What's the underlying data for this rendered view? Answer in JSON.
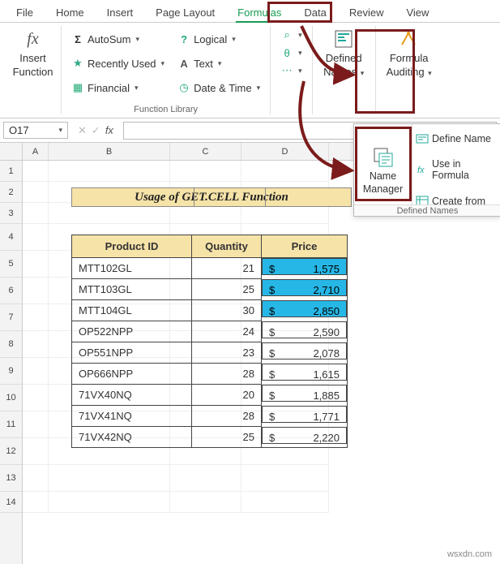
{
  "tabs": [
    "File",
    "Home",
    "Insert",
    "Page Layout",
    "Formulas",
    "Data",
    "Review",
    "View"
  ],
  "active_tab_index": 4,
  "ribbon": {
    "insert_function": {
      "label1": "Insert",
      "label2": "Function",
      "icon": "fx"
    },
    "library": {
      "auto_sum": "AutoSum",
      "recently_used": "Recently Used",
      "financial": "Financial",
      "logical": "Logical",
      "text": "Text",
      "date_time": "Date & Time",
      "group_label": "Function Library"
    },
    "mini_icons": [
      "lookup-icon",
      "math-icon",
      "more-icon"
    ],
    "defined_names": {
      "label1": "Defined",
      "label2": "Names"
    },
    "formula_auditing": {
      "label1": "Formula",
      "label2": "Auditing"
    }
  },
  "namebar": {
    "cell_ref": "O17",
    "fx": "fx"
  },
  "callout": {
    "name_manager": {
      "label1": "Name",
      "label2": "Manager"
    },
    "define_name": "Define Name",
    "use_in_formula": "Use in Formula",
    "create_from": "Create from",
    "group_label": "Defined Names"
  },
  "sheet": {
    "col_labels": [
      "A",
      "B",
      "C",
      "D"
    ],
    "row_labels": [
      "1",
      "2",
      "3",
      "4",
      "5",
      "6",
      "7",
      "8",
      "9",
      "10",
      "11",
      "12",
      "13",
      "14"
    ],
    "title": "Usage of GET.CELL Function",
    "headers": {
      "product_id": "Product ID",
      "quantity": "Quantity",
      "price": "Price"
    },
    "currency": "$",
    "rows": [
      {
        "pid": "MTT102GL",
        "qty": 21,
        "price": "1,575",
        "hl": true
      },
      {
        "pid": "MTT103GL",
        "qty": 25,
        "price": "2,710",
        "hl": true
      },
      {
        "pid": "MTT104GL",
        "qty": 30,
        "price": "2,850",
        "hl": true
      },
      {
        "pid": "OP522NPP",
        "qty": 24,
        "price": "2,590",
        "hl": false
      },
      {
        "pid": "OP551NPP",
        "qty": 23,
        "price": "2,078",
        "hl": false
      },
      {
        "pid": "OP666NPP",
        "qty": 28,
        "price": "1,615",
        "hl": false
      },
      {
        "pid": "71VX40NQ",
        "qty": 20,
        "price": "1,885",
        "hl": false
      },
      {
        "pid": "71VX41NQ",
        "qty": 28,
        "price": "1,771",
        "hl": false
      },
      {
        "pid": "71VX42NQ",
        "qty": 25,
        "price": "2,220",
        "hl": false
      }
    ]
  },
  "watermark": "wsxdn.com"
}
